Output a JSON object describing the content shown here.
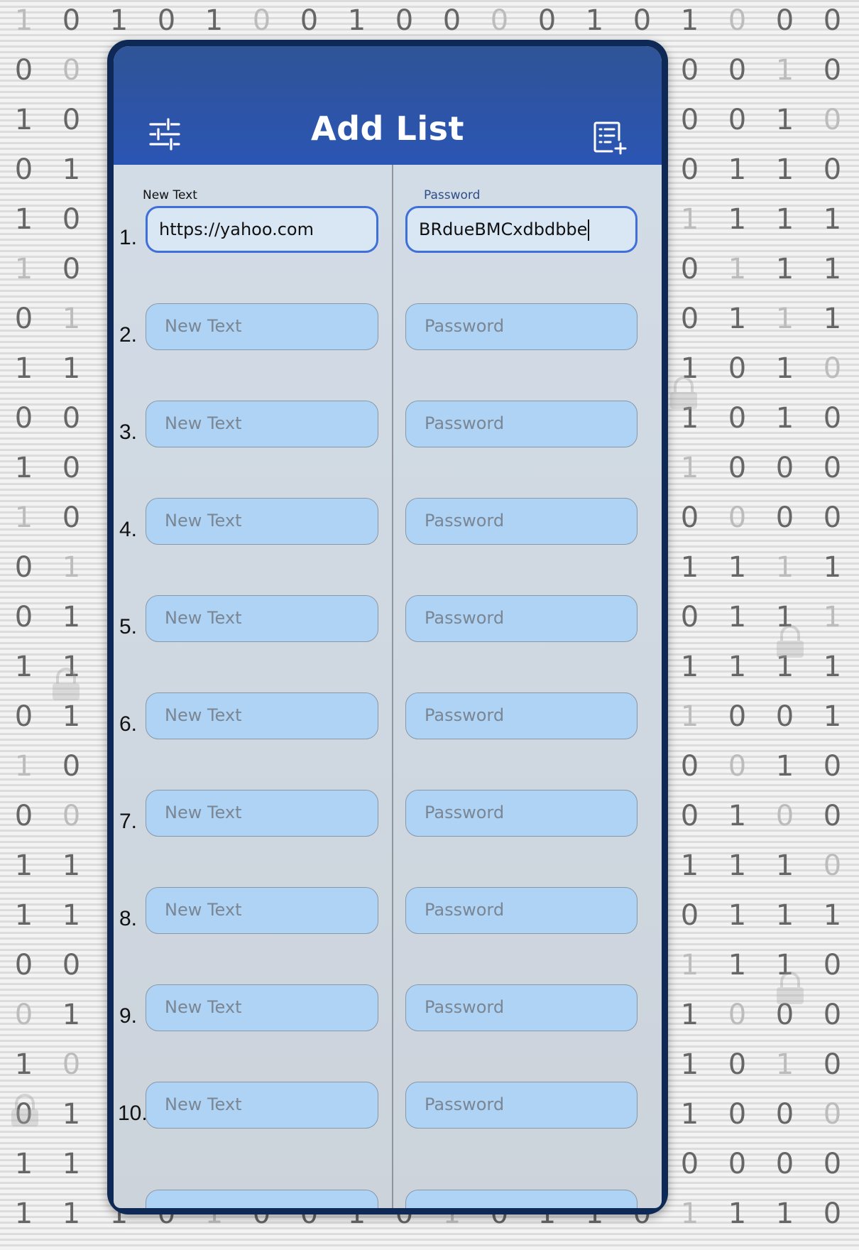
{
  "header": {
    "title": "Add List",
    "left_icon": "tune-sliders-icon",
    "right_icon": "add-list-icon"
  },
  "rows": [
    {
      "number": "1.",
      "url_label": "New Text",
      "url_value": "https://yahoo.com",
      "password_label": "Password",
      "password_value": "BRdueBMCxdbdbbe"
    },
    {
      "number": "2.",
      "url_placeholder": "New Text",
      "password_placeholder": "Password"
    },
    {
      "number": "3.",
      "url_placeholder": "New Text",
      "password_placeholder": "Password"
    },
    {
      "number": "4.",
      "url_placeholder": "New Text",
      "password_placeholder": "Password"
    },
    {
      "number": "5.",
      "url_placeholder": "New Text",
      "password_placeholder": "Password"
    },
    {
      "number": "6.",
      "url_placeholder": "New Text",
      "password_placeholder": "Password"
    },
    {
      "number": "7.",
      "url_placeholder": "New Text",
      "password_placeholder": "Password"
    },
    {
      "number": "8.",
      "url_placeholder": "New Text",
      "password_placeholder": "Password"
    },
    {
      "number": "9.",
      "url_placeholder": "New Text",
      "password_placeholder": "Password"
    },
    {
      "number": "10.",
      "url_placeholder": "New Text",
      "password_placeholder": "Password"
    }
  ],
  "background_digits": [
    "1010100100001010001",
    "0010110010000000100",
    "1011010010101000100",
    "0110010111000001100",
    "1010101001110011111",
    "1001110010101001110",
    "0101101100101001110",
    "1101110110011010100",
    "0000101101001010101",
    "1010110010100110001",
    "1001010011100100000",
    "0111101110101011111",
    "0110110110111101110",
    "1110110100110111110",
    "0110000110101010011",
    "1010110101011100101",
    "0000000101000001001",
    "1110100011100111101",
    "1110111100010101110",
    "0001000010000111100",
    "0100101000000010000",
    "1011100101100110100",
    "0110110000000010000",
    "1110000000000000001",
    "1110100101011011100"
  ],
  "colors": {
    "header": "#2b55b4",
    "field_fill": "#afd3f4",
    "active_border": "#3f6fd8",
    "frame": "#0f2957"
  }
}
